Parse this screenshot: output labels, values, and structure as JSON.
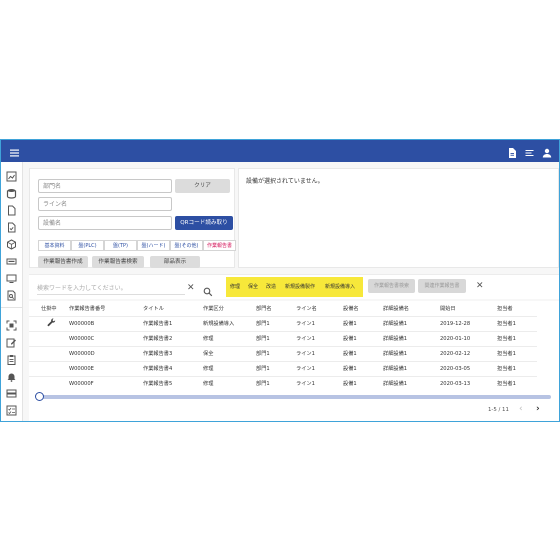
{
  "sidebar": {
    "icons": [
      "data-chart-icon",
      "database-icon",
      "document-icon",
      "document-check-icon",
      "cube-icon",
      "storage-icon",
      "monitor-icon",
      "search-document-icon",
      "qr-scan-icon",
      "edit-icon",
      "clipboard-icon",
      "bell-icon",
      "server-icon",
      "checklist-icon",
      "help-icon"
    ]
  },
  "header": {
    "menu_icon": "menu-icon",
    "right_icons": [
      "report-icon",
      "list-icon",
      "account-icon"
    ]
  },
  "filters": {
    "department_placeholder": "部門名",
    "line_placeholder": "ライン名",
    "equipment_placeholder": "設備名",
    "clear_label": "クリア",
    "qr_label": "QRコード読み取り",
    "categories": [
      "基本資料",
      "盤(PLC)",
      "盤(TP)",
      "盤(ハード)",
      "盤(その他)",
      "作業報告書"
    ],
    "create_report_label": "作業報告書作成",
    "search_report_label": "作業報告書検索",
    "parts_label": "部品表示"
  },
  "info": {
    "message": "設備が選択されていません。"
  },
  "toolbar": {
    "search_placeholder": "検索ワードを入力してください。",
    "chips": [
      "修理",
      "保全",
      "改造",
      "新規設備製作",
      "新規設備導入"
    ],
    "search_report_btn": "作業報告書検索",
    "related_report_btn": "関連作業報告書"
  },
  "table": {
    "headers": [
      "仕掛中",
      "作業報告書番号",
      "タイトル",
      "作業区分",
      "部門名",
      "ライン名",
      "設備名",
      "詳細設備名",
      "開始日",
      "担当者"
    ],
    "rows": [
      {
        "wip": "wrench-icon",
        "no": "W00000B",
        "title": "作業報告書1",
        "type": "新規設備導入",
        "dept": "部門1",
        "line": "ライン1",
        "equip": "設備1",
        "detail": "詳細設備1",
        "date": "2019-12-28",
        "person": "担当者1"
      },
      {
        "wip": "",
        "no": "W00000C",
        "title": "作業報告書2",
        "type": "修理",
        "dept": "部門1",
        "line": "ライン1",
        "equip": "設備1",
        "detail": "詳細設備1",
        "date": "2020-01-10",
        "person": "担当者1"
      },
      {
        "wip": "",
        "no": "W00000D",
        "title": "作業報告書3",
        "type": "保全",
        "dept": "部門1",
        "line": "ライン1",
        "equip": "設備1",
        "detail": "詳細設備1",
        "date": "2020-02-12",
        "person": "担当者1"
      },
      {
        "wip": "",
        "no": "W00000E",
        "title": "作業報告書4",
        "type": "修理",
        "dept": "部門1",
        "line": "ライン1",
        "equip": "設備1",
        "detail": "詳細設備1",
        "date": "2020-03-05",
        "person": "担当者1"
      },
      {
        "wip": "",
        "no": "W00000F",
        "title": "作業報告書5",
        "type": "修理",
        "dept": "部門1",
        "line": "ライン1",
        "equip": "設備1",
        "detail": "詳細設備1",
        "date": "2020-03-13",
        "person": "担当者1"
      }
    ]
  },
  "pagination": {
    "range": "1-5 / 11"
  },
  "slider": {
    "value": 0
  },
  "colors": {
    "primary": "#2d4fa3",
    "chip_bg": "#f7e83a",
    "accent_red": "#d4145a"
  }
}
